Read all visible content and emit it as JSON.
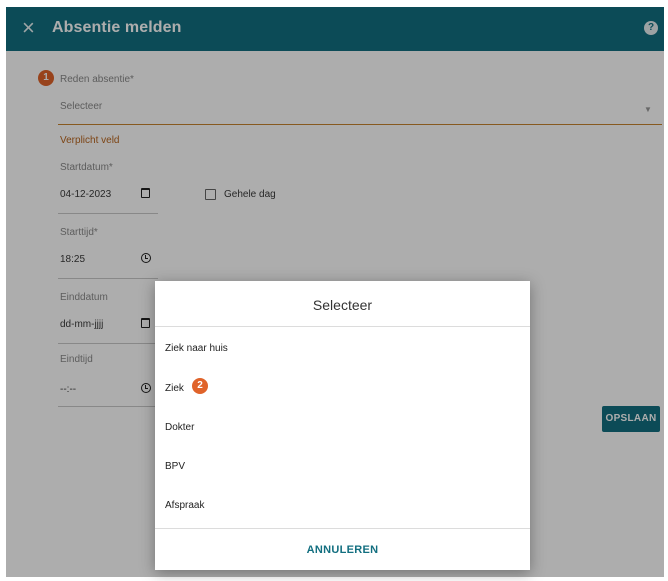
{
  "header": {
    "close_glyph": "×",
    "title": "Absentie melden",
    "help_glyph": "?"
  },
  "form": {
    "step1_badge": "1",
    "reason": {
      "label": "Reden absentie*",
      "placeholder": "Selecteer",
      "error": "Verplicht veld"
    },
    "start_date": {
      "label": "Startdatum*",
      "value": "04-12-2023"
    },
    "whole_day": {
      "label": "Gehele dag",
      "checked": false
    },
    "start_time": {
      "label": "Starttijd*",
      "value": "18:25"
    },
    "end_date": {
      "label": "Einddatum",
      "value": "dd-mm-jjjj"
    },
    "end_time": {
      "label": "Eindtijd",
      "value": "--:--"
    },
    "save_label": "OPSLAAN"
  },
  "dialog": {
    "title": "Selecteer",
    "options": [
      "Ziek naar huis",
      "Ziek",
      "Dokter",
      "BPV",
      "Afspraak"
    ],
    "step2_badge": "2",
    "cancel_label": "ANNULEREN"
  },
  "colors": {
    "primary": "#136f80",
    "accent_badge": "#e0632a",
    "error": "#b8651e"
  },
  "icons": [
    "close-icon",
    "help-icon",
    "calendar-icon",
    "clock-icon",
    "dropdown-arrow-icon",
    "checkbox-icon"
  ]
}
